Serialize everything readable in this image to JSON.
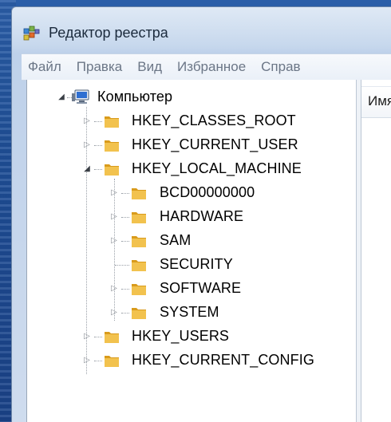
{
  "window": {
    "title": "Редактор реестра"
  },
  "menu": {
    "items": [
      {
        "label": "Файл"
      },
      {
        "label": "Правка"
      },
      {
        "label": "Вид"
      },
      {
        "label": "Избранное"
      },
      {
        "label": "Справ"
      }
    ]
  },
  "tree": {
    "root": {
      "label": "Компьютер",
      "icon": "computer-icon",
      "expanded": true
    },
    "hives": [
      {
        "label": "HKEY_CLASSES_ROOT",
        "expanded": false
      },
      {
        "label": "HKEY_CURRENT_USER",
        "expanded": false
      },
      {
        "label": "HKEY_LOCAL_MACHINE",
        "expanded": true
      },
      {
        "label": "HKEY_USERS",
        "expanded": false
      },
      {
        "label": "HKEY_CURRENT_CONFIG",
        "expanded": false
      }
    ],
    "hklm_children": [
      {
        "label": "BCD00000000",
        "has_children": true
      },
      {
        "label": "HARDWARE",
        "has_children": true
      },
      {
        "label": "SAM",
        "has_children": true
      },
      {
        "label": "SECURITY",
        "has_children": false
      },
      {
        "label": "SOFTWARE",
        "has_children": true
      },
      {
        "label": "SYSTEM",
        "has_children": true
      }
    ]
  },
  "list": {
    "column_name": "Имя"
  },
  "colors": {
    "folder_front": "#f2c24e",
    "folder_back": "#d99b1c",
    "chrome": "#bed1ea",
    "desktop": "#1f4f97"
  }
}
